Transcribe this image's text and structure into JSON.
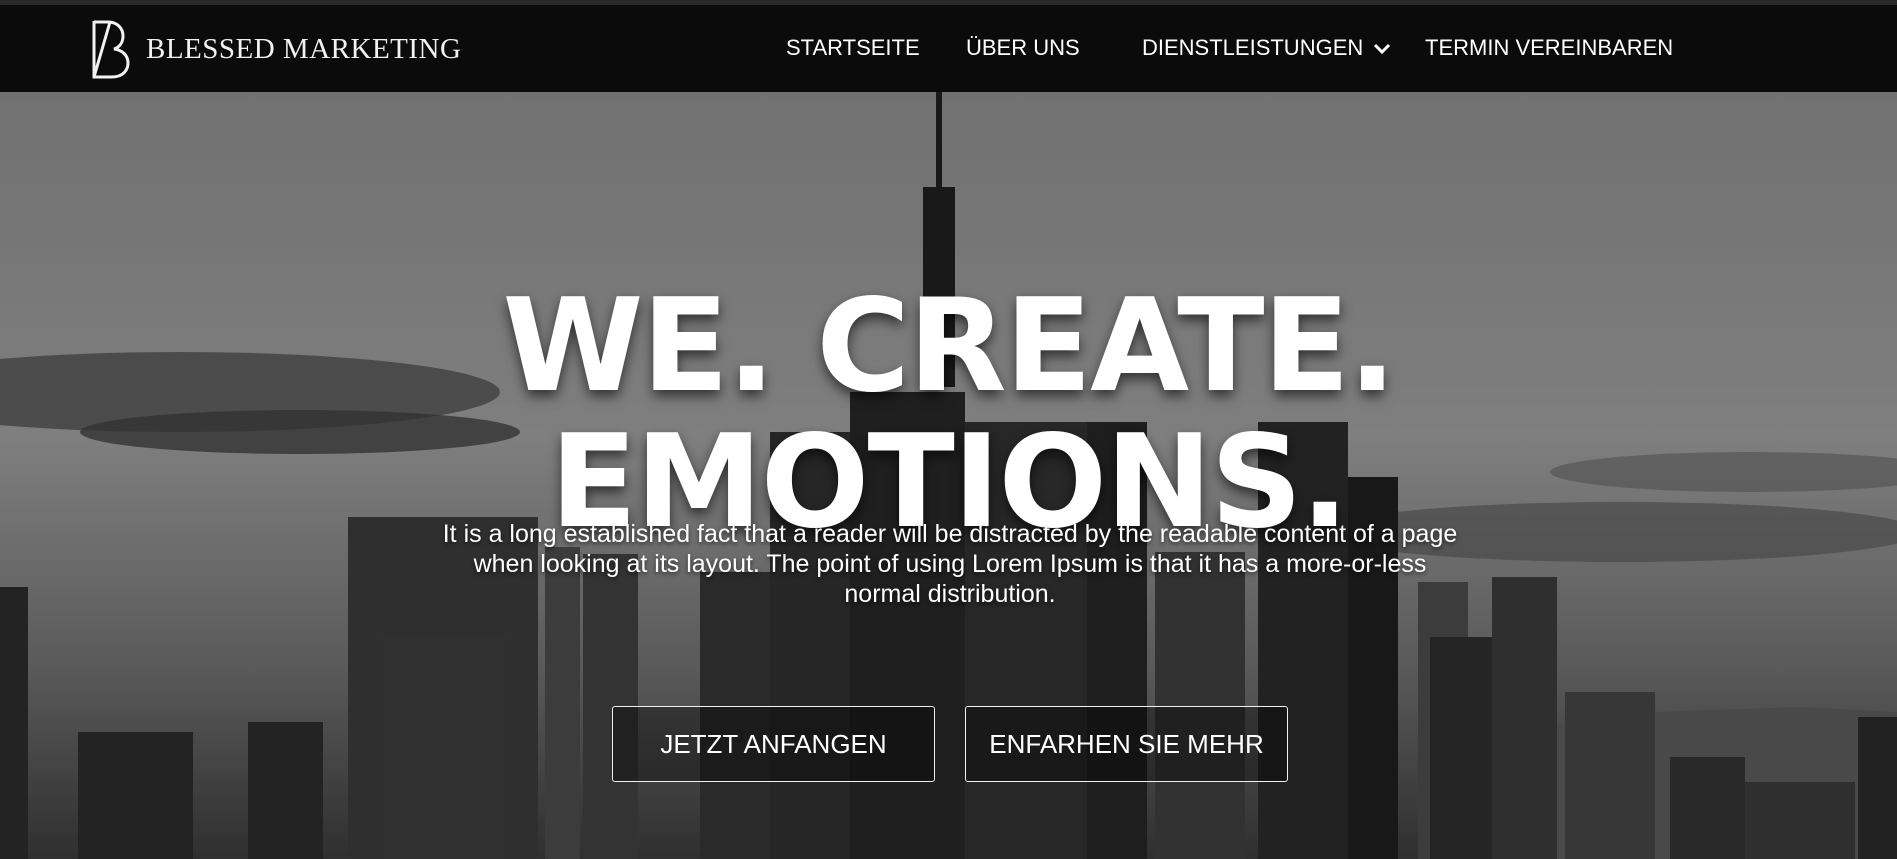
{
  "brand": {
    "name": "BLESSED MARKETING",
    "logo_icon": "b-monogram-icon"
  },
  "nav": {
    "items": [
      {
        "label": "STARTSEITE"
      },
      {
        "label": "ÜBER UNS"
      },
      {
        "label": "DIENSTLEISTUNGEN",
        "icon": "chevron-down-icon"
      },
      {
        "label": "TERMIN VEREINBAREN"
      }
    ]
  },
  "hero": {
    "headline_line1": "WE. CREATE.",
    "headline_line2": "EMOTIONS.",
    "description": "It is a long established fact that a reader will be distracted by the readable content of a page when looking at its layout. The point of using Lorem Ipsum is that it has a more-or-less normal distribution.",
    "primary_button": "JETZT ANFANGEN",
    "secondary_button": "ENFARHEN SIE MEHR"
  },
  "colors": {
    "header_bg": "#0b0b0b",
    "text": "#ffffff"
  }
}
